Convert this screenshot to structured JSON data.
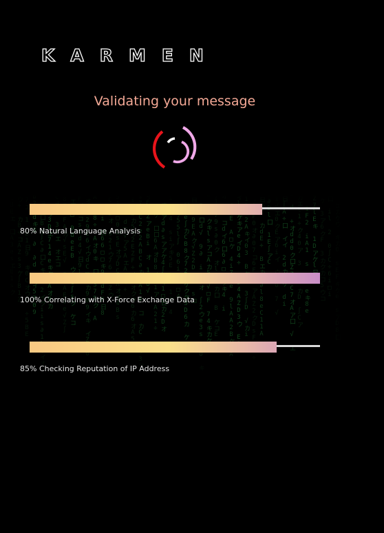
{
  "brand": {
    "logo_text": "KARMEN"
  },
  "status": {
    "title": "Validating your message"
  },
  "spinner": {
    "icon": "loading-spinner-icon",
    "colors": {
      "outer": "#e8141b",
      "inner": "#f0a8e8"
    }
  },
  "progress": {
    "gradient": [
      "#f9c983",
      "#fbe08a",
      "#e8b9a8",
      "#c98ec7"
    ],
    "track_color": "#d9d9d9",
    "items": [
      {
        "percent": 80,
        "label": "80% Natural Language Analysis"
      },
      {
        "percent": 100,
        "label": "100% Correlating with X-Force Exchange Data"
      },
      {
        "percent": 85,
        "label": "85% Checking Reputation of IP Address"
      }
    ]
  },
  "background": {
    "effect": "matrix-code-rain",
    "color": "#1b6b2c"
  }
}
